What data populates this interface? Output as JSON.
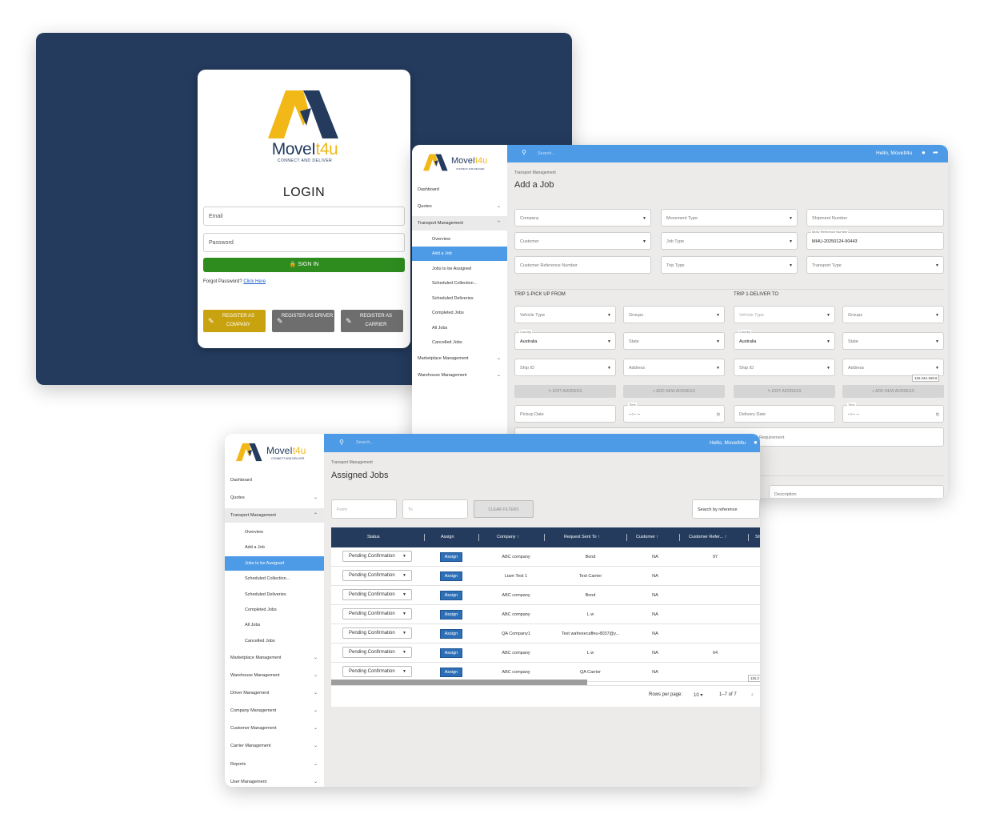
{
  "brand": {
    "name_a": "MoveI",
    "name_b": "t4u",
    "tagline": "CONNECT AND DELIVER"
  },
  "login": {
    "title": "LOGIN",
    "email_placeholder": "Email",
    "password_placeholder": "Password",
    "signin_label": "SIGN IN",
    "forgot_text": "Forgot Password?",
    "forgot_link": "Click Here",
    "register_company": "REGISTER AS COMPANY",
    "register_driver": "REGISTER AS DRIVER",
    "register_carrier": "REGISTER AS CARRIER"
  },
  "add_job": {
    "search_placeholder": "Search...",
    "greeting": "Hello, MoveIt4u",
    "sidebar": {
      "dashboard": "Dashboard",
      "quotes": "Quotes",
      "transport": "Transport Management",
      "overview": "Overview",
      "add_job": "Add a Job",
      "jobs_assigned": "Jobs to be Assigned",
      "scheduled_collection": "Scheduled Collection...",
      "scheduled_deliveries": "Scheduled Deliveries",
      "completed": "Completed Jobs",
      "all_jobs": "All Jobs",
      "cancelled": "Cancelled Jobs",
      "marketplace": "Marketplace Management",
      "warehouse": "Warehouse Management"
    },
    "breadcrumb": "Transport Management",
    "title": "Add a Job",
    "fields": {
      "company": "Company",
      "movement_type": "Movement Type",
      "shipment_number": "Shipment Number",
      "customer": "Customer",
      "job_type": "Job Type",
      "ref_label": "MI4U Reference Number",
      "ref_value": "MI4U-20250124-90443",
      "customer_ref": "Customer Reference Number",
      "trip_type": "Trip Type",
      "transport_type": "Transport Type"
    },
    "pickup": {
      "heading": "TRIP 1-PICK UP FROM",
      "vehicle_type": "Vehicle Type",
      "groups": "Groups",
      "country_label": "Country",
      "country": "Australia",
      "state": "State",
      "ship_id": "Ship ID",
      "address": "Address",
      "edit_address": "EDIT ADDRESS",
      "add_address": "ADD NEW ADDRESS",
      "date": "Pickup Date",
      "time_label": "Time",
      "time_value": "--:-- --"
    },
    "deliver": {
      "heading": "TRIP 1-DELIVER TO",
      "vehicle_type": "Vehicle Type",
      "groups": "Groups",
      "country_label": "Country",
      "country": "Australia",
      "state": "State",
      "ship_id": "Ship ID",
      "address": "Address",
      "edit_address": "EDIT ADDRESS",
      "add_address": "ADD NEW ADDRESS",
      "date": "Delivery Date",
      "time_label": "Time",
      "time_value": "--:-- --",
      "requirement": "Requirement",
      "description": "Description"
    },
    "ip": "115.244.159.6"
  },
  "assigned": {
    "search_placeholder": "Search...",
    "greeting": "Hello, MoveIt4u",
    "sidebar": {
      "dashboard": "Dashboard",
      "quotes": "Quotes",
      "transport": "Transport Management",
      "overview": "Overview",
      "add_job": "Add a Job",
      "jobs_assigned": "Jobs to be Assigned",
      "scheduled_collection": "Scheduled Collection...",
      "scheduled_deliveries": "Scheduled Deliveries",
      "completed": "Completed Jobs",
      "all_jobs": "All Jobs",
      "cancelled": "Cancelled Jobs",
      "marketplace": "Marketplace Management",
      "warehouse": "Warehouse Management",
      "driver": "Driver Management",
      "company": "Company Management",
      "customer": "Customer Management",
      "carrier": "Carrier Management",
      "reports": "Reports",
      "user": "User Management"
    },
    "breadcrumb": "Transport Management",
    "title": "Assigned Jobs",
    "filters": {
      "from": "From",
      "to": "To",
      "clear": "CLEAR FILTERS",
      "search_ref": "Search by reference"
    },
    "columns": [
      "Status",
      "Assign",
      "Company",
      "Request Sent To",
      "Customer",
      "Customer Refer...",
      "Sh"
    ],
    "assign_label": "Assign",
    "rows": [
      {
        "status": "Pending Confirmation",
        "company": "ABC company",
        "sent_to": "Bond",
        "customer": "NA",
        "ref": "97"
      },
      {
        "status": "Pending Confirmation",
        "company": "Liam Test 1",
        "sent_to": "Test Carrier",
        "customer": "NA",
        "ref": ""
      },
      {
        "status": "Pending Confirmation",
        "company": "ABC company",
        "sent_to": "Bond",
        "customer": "NA",
        "ref": ""
      },
      {
        "status": "Pending Confirmation",
        "company": "ABC company",
        "sent_to": "L w",
        "customer": "NA",
        "ref": ""
      },
      {
        "status": "Pending Confirmation",
        "company": "QA Company1",
        "sent_to": "Test wafrexecaffeu-8037@y...",
        "customer": "NA",
        "ref": ""
      },
      {
        "status": "Pending Confirmation",
        "company": "ABC company",
        "sent_to": "L w",
        "customer": "NA",
        "ref": "64"
      },
      {
        "status": "Pending Confirmation",
        "company": "ABC company",
        "sent_to": "QA Carrier",
        "customer": "NA",
        "ref": ""
      }
    ],
    "pagination": {
      "rows_label": "Rows per page:",
      "rows_value": "10",
      "range": "1–7 of 7"
    },
    "ip": "115.2"
  }
}
